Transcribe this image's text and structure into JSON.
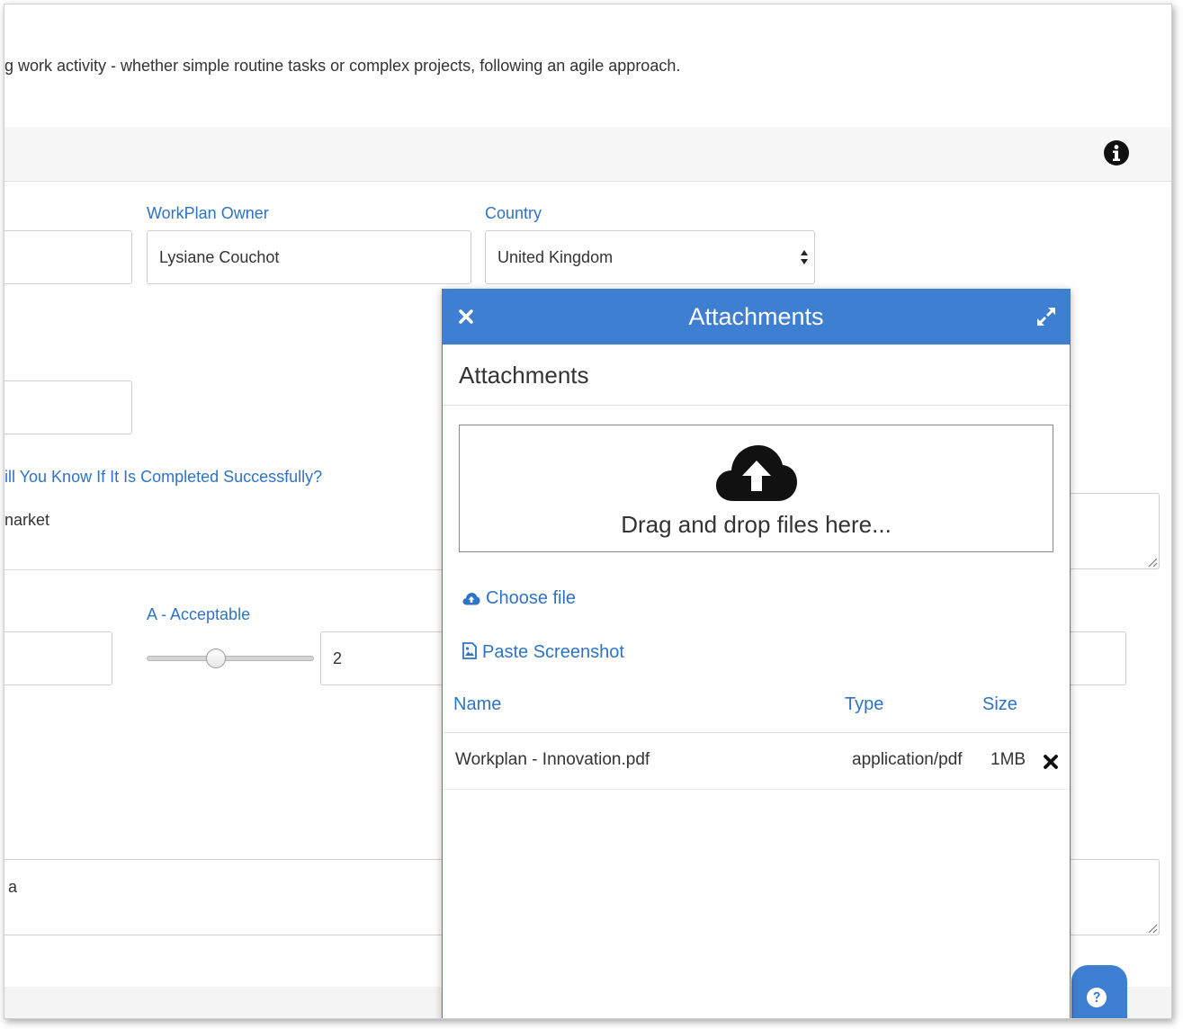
{
  "intro_text": "g work activity - whether simple routine tasks or complex projects, following an agile approach.",
  "header": {
    "info_icon": "info-circle-icon"
  },
  "form": {
    "workplan_owner_label": "WorkPlan Owner",
    "workplan_owner_value": "Lysiane Couchot",
    "country_label": "Country",
    "country_value": "United Kingdom",
    "success_question_label": "ill You Know If It Is Completed Successfully?",
    "success_answer_text": "narket",
    "acceptable_label": "A - Acceptable",
    "acceptable_value": "2",
    "bottom_text": "a"
  },
  "modal": {
    "title": "Attachments",
    "heading": "Attachments",
    "dropzone_text": "Drag and drop files here...",
    "choose_file": "Choose file",
    "paste_screenshot": "Paste Screenshot",
    "columns": {
      "name": "Name",
      "type": "Type",
      "size": "Size"
    },
    "files": [
      {
        "name": "Workplan - Innovation.pdf",
        "type": "application/pdf",
        "size": "1MB"
      }
    ]
  },
  "colors": {
    "accent": "#3f7fd1",
    "link": "#2f73c4",
    "header_bg": "#f7f7f7"
  }
}
